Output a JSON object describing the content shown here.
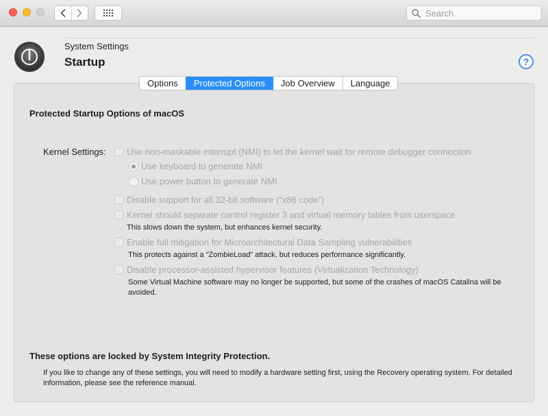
{
  "toolbar": {
    "search_placeholder": "Search"
  },
  "header": {
    "subtitle": "System Settings",
    "title": "Startup",
    "help_label": "?"
  },
  "tabs": [
    {
      "label": "Options",
      "active": false
    },
    {
      "label": "Protected Options",
      "active": true
    },
    {
      "label": "Job Overview",
      "active": false
    },
    {
      "label": "Language",
      "active": false
    }
  ],
  "content": {
    "section_title": "Protected Startup Options of macOS",
    "kernel_label": "Kernel Settings:",
    "options": {
      "nmi": "Use non-maskable interrupt (NMI) to let the kernel wait for remote debugger connection",
      "nmi_keyboard": "Use keyboard to generate NMI",
      "nmi_power": "Use power button to generate NMI",
      "disable32": "Disable support for all 32-bit software (“x86 code”)",
      "separate_cr3": "Kernel should separate control register 3 and virtual memory tables from userspace",
      "separate_cr3_note": "This slows down the system, but enhances kernel security.",
      "mds": "Enable full mitigation for Microarchitectural Data Sampling vulnerabilities",
      "mds_note": "This protects against a “ZombieLoad” attack, but reduces performance significantly.",
      "hypervisor": "Disable processor-assisted hypervisor features (Virtualization Technology)",
      "hypervisor_note": "Some Virtual Machine software may no longer be supported, but some of the crashes of macOS Catalina will be avoided."
    },
    "locked_title": "These options are locked by System Integrity Protection.",
    "locked_text": "If you like to change any of these settings, you will need to modify a hardware setting first, using the Recovery operating system. For detailed information, please see the reference manual."
  },
  "colors": {
    "accent": "#2a8ef7",
    "disabled_text": "#a6a6a6"
  },
  "icons": {
    "app": "power-icon",
    "back": "chevron-left-icon",
    "forward": "chevron-right-icon",
    "grid": "grid-icon",
    "search": "search-icon",
    "help": "help-icon"
  }
}
